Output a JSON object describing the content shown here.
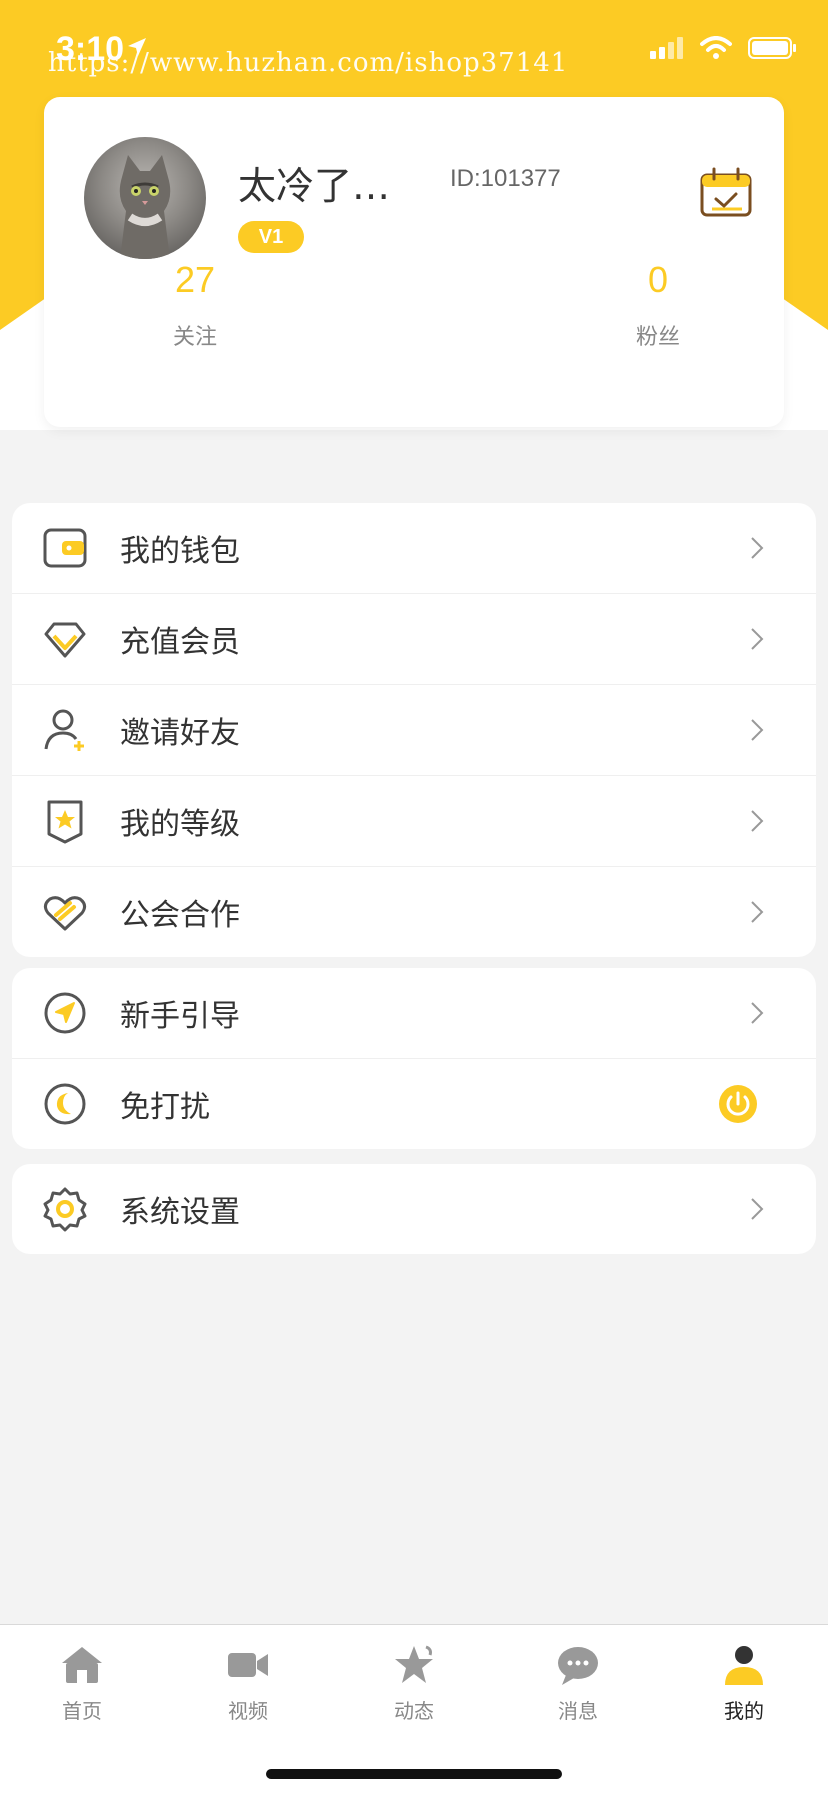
{
  "status_bar": {
    "time": "3:10",
    "watermark": "https://www.huzhan.com/ishop37141"
  },
  "profile": {
    "username": "太冷了…",
    "user_id": "ID:101377",
    "level": "V1",
    "stats": [
      {
        "value": "27",
        "label": "关注"
      },
      {
        "value": "0",
        "label": "粉丝"
      }
    ]
  },
  "menu_groups": [
    {
      "items": [
        {
          "label": "我的钱包",
          "icon": "wallet-icon"
        },
        {
          "label": "充值会员",
          "icon": "diamond-icon"
        },
        {
          "label": "邀请好友",
          "icon": "add-user-icon"
        },
        {
          "label": "我的等级",
          "icon": "level-badge-icon"
        },
        {
          "label": "公会合作",
          "icon": "partnership-icon"
        }
      ]
    },
    {
      "items": [
        {
          "label": "新手引导",
          "icon": "guide-icon"
        },
        {
          "label": "免打扰",
          "icon": "moon-icon",
          "toggle": "on"
        }
      ]
    },
    {
      "items": [
        {
          "label": "系统设置",
          "icon": "gear-icon"
        }
      ]
    }
  ],
  "tabs": [
    {
      "label": "首页",
      "icon": "home-icon"
    },
    {
      "label": "视频",
      "icon": "video-icon"
    },
    {
      "label": "动态",
      "icon": "star-icon"
    },
    {
      "label": "消息",
      "icon": "chat-icon"
    },
    {
      "label": "我的",
      "icon": "profile-icon",
      "active": true
    }
  ],
  "colors": {
    "accent": "#fccb24",
    "icon_gray": "#555555"
  }
}
